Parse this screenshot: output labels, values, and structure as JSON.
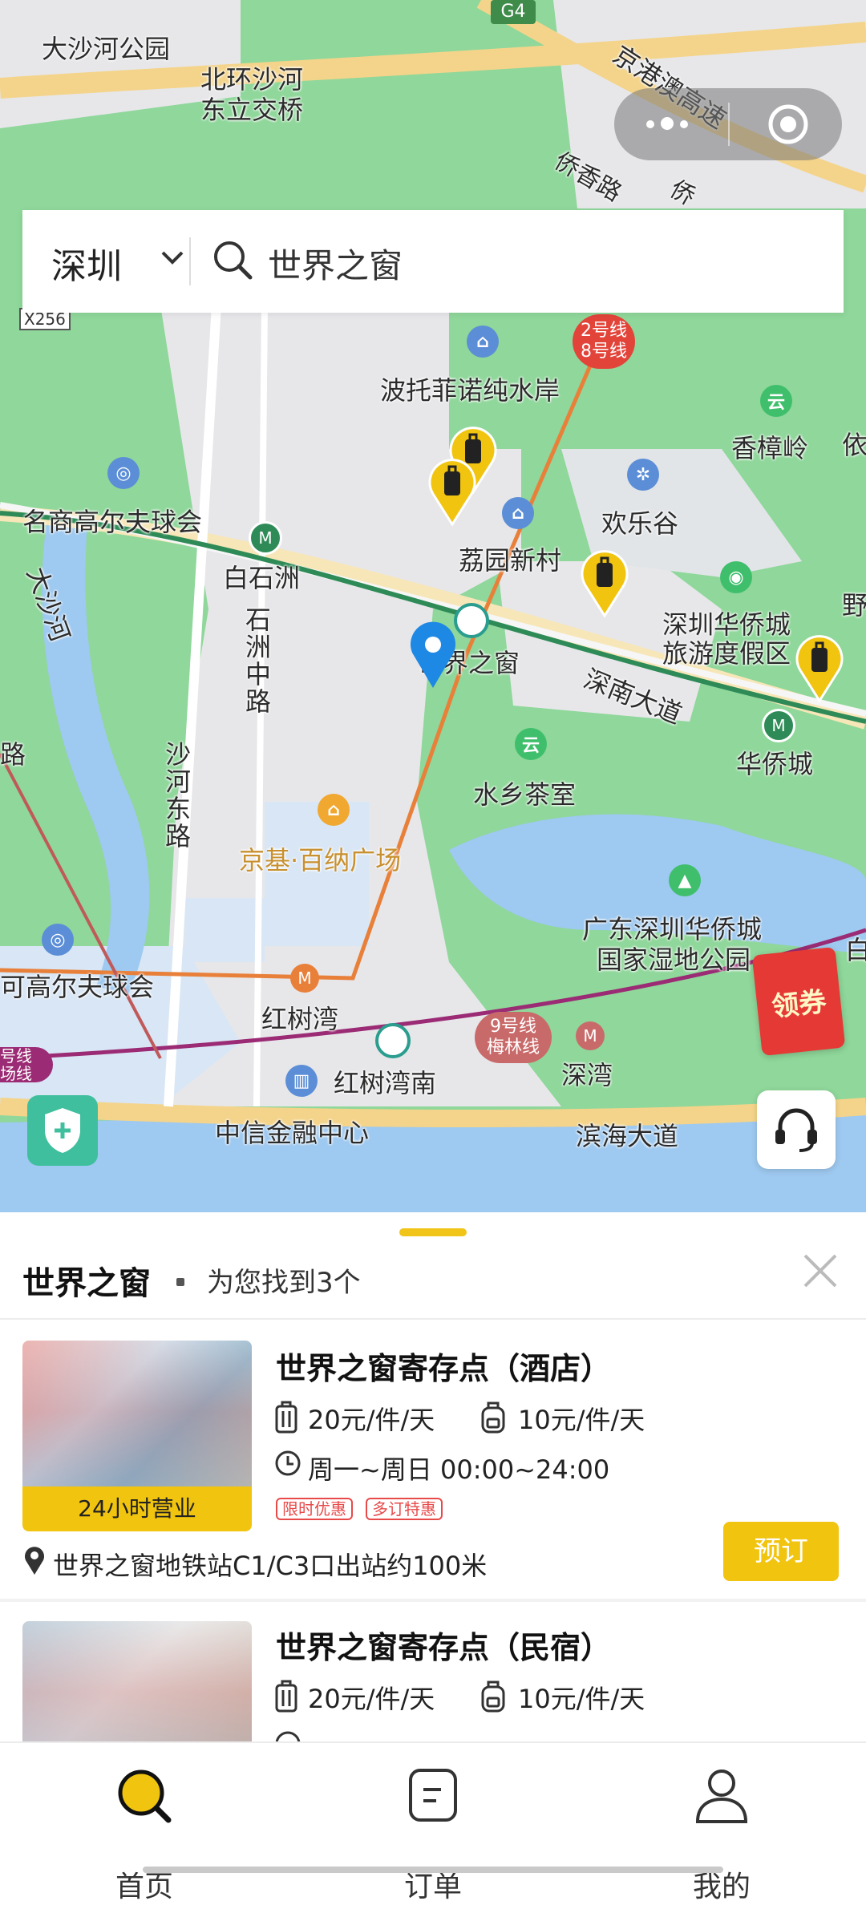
{
  "map": {
    "labels": {
      "dashahe_park": "大沙河公园",
      "beihuan_1": "北环沙河",
      "beihuan_2": "东立交桥",
      "gangao": "京港澳高速",
      "qiaoxiang": "侨香路",
      "qiao": "侨",
      "g4": "G4",
      "x256": "X256",
      "pontofino": "波托菲诺纯水岸",
      "line_2": "2号线",
      "line_8": "8号线",
      "xiangzhangling": "香樟岭",
      "mingshang": "名商高尔夫球会",
      "baishizhou": "白石洲",
      "liyuan": "荔园新村",
      "happy_valley": "欢乐谷",
      "ocf_1": "深圳华侨城",
      "ocf_2": "旅游度假区",
      "dashahe_river": "大沙河",
      "shizhou_road": "石洲中路",
      "window_world": "世界之窗",
      "shennan": "深南大道",
      "huaqiaocheng": "华侨城",
      "lu": "路",
      "shahe_east": "沙河东路",
      "water_tea": "水乡茶室",
      "jingji": "京基·百纳广场",
      "wetland_1": "广东深圳华侨城",
      "wetland_2": "国家湿地公园",
      "golf_left": "可高尔夫球会",
      "hongshuwan": "红树湾",
      "line9_1": "9号线",
      "line9_2": "梅林线",
      "shenwan": "深湾",
      "hongshuwan_south": "红树湾南",
      "citic": "中信金融中心",
      "binhai": "滨海大道",
      "hao_xian": "号线",
      "chang_xian": "场线",
      "ye": "野",
      "bai": "白"
    }
  },
  "search": {
    "city": "深圳",
    "query": "世界之窗"
  },
  "floating": {
    "coupon": "领券"
  },
  "panel": {
    "title": "世界之窗",
    "count": "为您找到3个",
    "results": [
      {
        "name": "世界之窗寄存点（酒店）",
        "badge": "24小时营业",
        "price_large": "20元/件/天",
        "price_small": "10元/件/天",
        "hours": "周一~周日 00:00~24:00",
        "tags": [
          "限时优惠",
          "多订特惠"
        ],
        "address": "世界之窗地铁站C1/C3口出站约100米",
        "book_label": "预订"
      },
      {
        "name": "世界之窗寄存点（民宿）",
        "price_large": "20元/件/天",
        "price_small": "10元/件/天"
      }
    ]
  },
  "tabbar": {
    "home": "首页",
    "orders": "订单",
    "mine": "我的"
  },
  "colors": {
    "accent": "#f1c40f",
    "map_green": "#8fd79a",
    "pin_blue": "#1e88e5",
    "coupon_red": "#e53935"
  }
}
